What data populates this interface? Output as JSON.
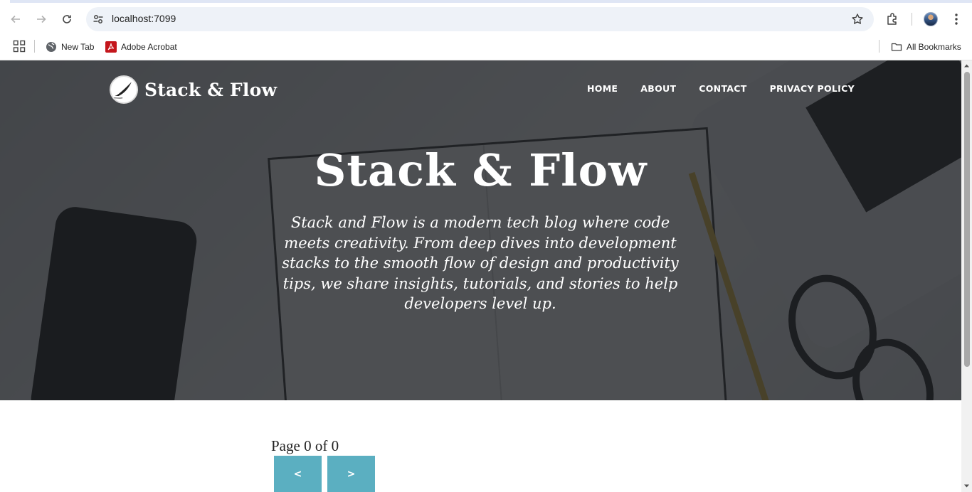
{
  "browser": {
    "url": "localhost:7099",
    "bookmarks": [
      {
        "label": "New Tab",
        "icon": "globe-icon"
      },
      {
        "label": "Adobe Acrobat",
        "icon": "acrobat-icon"
      }
    ],
    "all_bookmarks_label": "All Bookmarks"
  },
  "site": {
    "brand_name": "Stack & Flow",
    "nav": [
      {
        "label": "HOME"
      },
      {
        "label": "ABOUT"
      },
      {
        "label": "CONTACT"
      },
      {
        "label": "PRIVACY POLICY"
      }
    ],
    "hero_title": "Stack & Flow",
    "hero_subtitle": "Stack and Flow is a modern tech blog where code meets creativity. From deep dives into development stacks to the smooth flow of design and productivity tips, we share insights, tutorials, and stories to help developers level up."
  },
  "pagination": {
    "status": "Page 0 of 0",
    "prev_label": "<",
    "next_label": ">"
  },
  "colors": {
    "accent": "#5bafc1",
    "hero_overlay": "#1e2024"
  }
}
